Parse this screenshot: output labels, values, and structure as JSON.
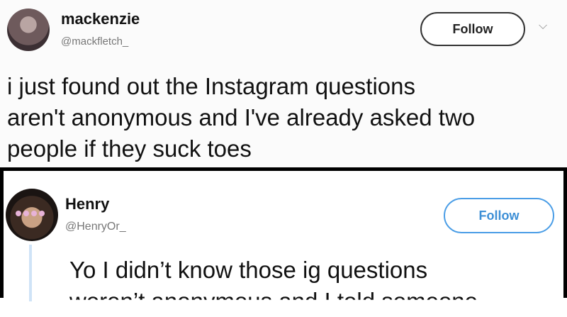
{
  "tweet1": {
    "name": "mackenzie",
    "handle": "@mackfletch_",
    "follow_label": "Follow",
    "menu_icon": "chevron-down-icon",
    "text_lines": [
      "i just found out the Instagram questions",
      "aren't anonymous and I've already asked two",
      "people if they suck toes"
    ]
  },
  "tweet2": {
    "name": "Henry",
    "handle": "@HenryOr_",
    "follow_label": "Follow",
    "follow_color": "#3d8fd6",
    "text_lines": [
      "Yo I didn’t know those ig questions",
      "weren’t anonymous and I told someone"
    ]
  }
}
